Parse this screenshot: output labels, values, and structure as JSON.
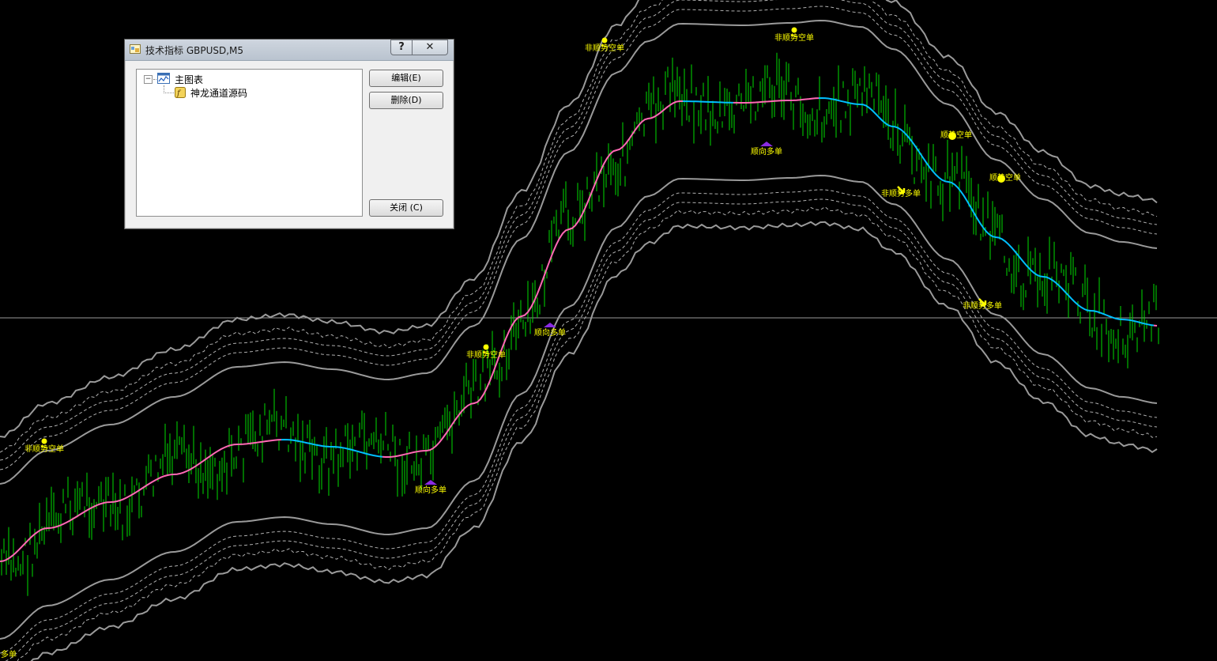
{
  "chart": {
    "background": "#000000",
    "bar_color": "#00dd00",
    "ma_up_color": "#ff69b4",
    "ma_down_color": "#00bfff",
    "band_outer_color": "#9a9a9a",
    "band_inner_color": "#b0b0b0",
    "label_color": "#ffff00",
    "signals": [
      {
        "text": "非顺势空单",
        "kind": "skull"
      },
      {
        "text": "顺向多单",
        "kind": "arrow-up"
      },
      {
        "text": "非顺势空单",
        "kind": "skull"
      },
      {
        "text": "顺向多单",
        "kind": "arrow-up"
      },
      {
        "text": "非顺势空单",
        "kind": "skull"
      },
      {
        "text": "非顺势空单",
        "kind": "skull"
      },
      {
        "text": "顺向多单",
        "kind": "arrow-up"
      },
      {
        "text": "顺势空单",
        "kind": "smiley"
      },
      {
        "text": "非顺势多单",
        "kind": "arrow-down"
      },
      {
        "text": "顺势空单",
        "kind": "smiley"
      },
      {
        "text": "非顺势多单",
        "kind": "arrow-down"
      },
      {
        "text": "多单",
        "kind": "text"
      }
    ]
  },
  "dialog": {
    "title": "技术指标 GBPUSD,M5",
    "help_button": "?",
    "close_button": "✕",
    "tree": {
      "root_label": "主图表",
      "expander": "−",
      "child_label": "神龙通道源码"
    },
    "buttons": {
      "edit": "编辑(E)",
      "delete": "删除(D)",
      "close": "关闭 (C)"
    }
  }
}
